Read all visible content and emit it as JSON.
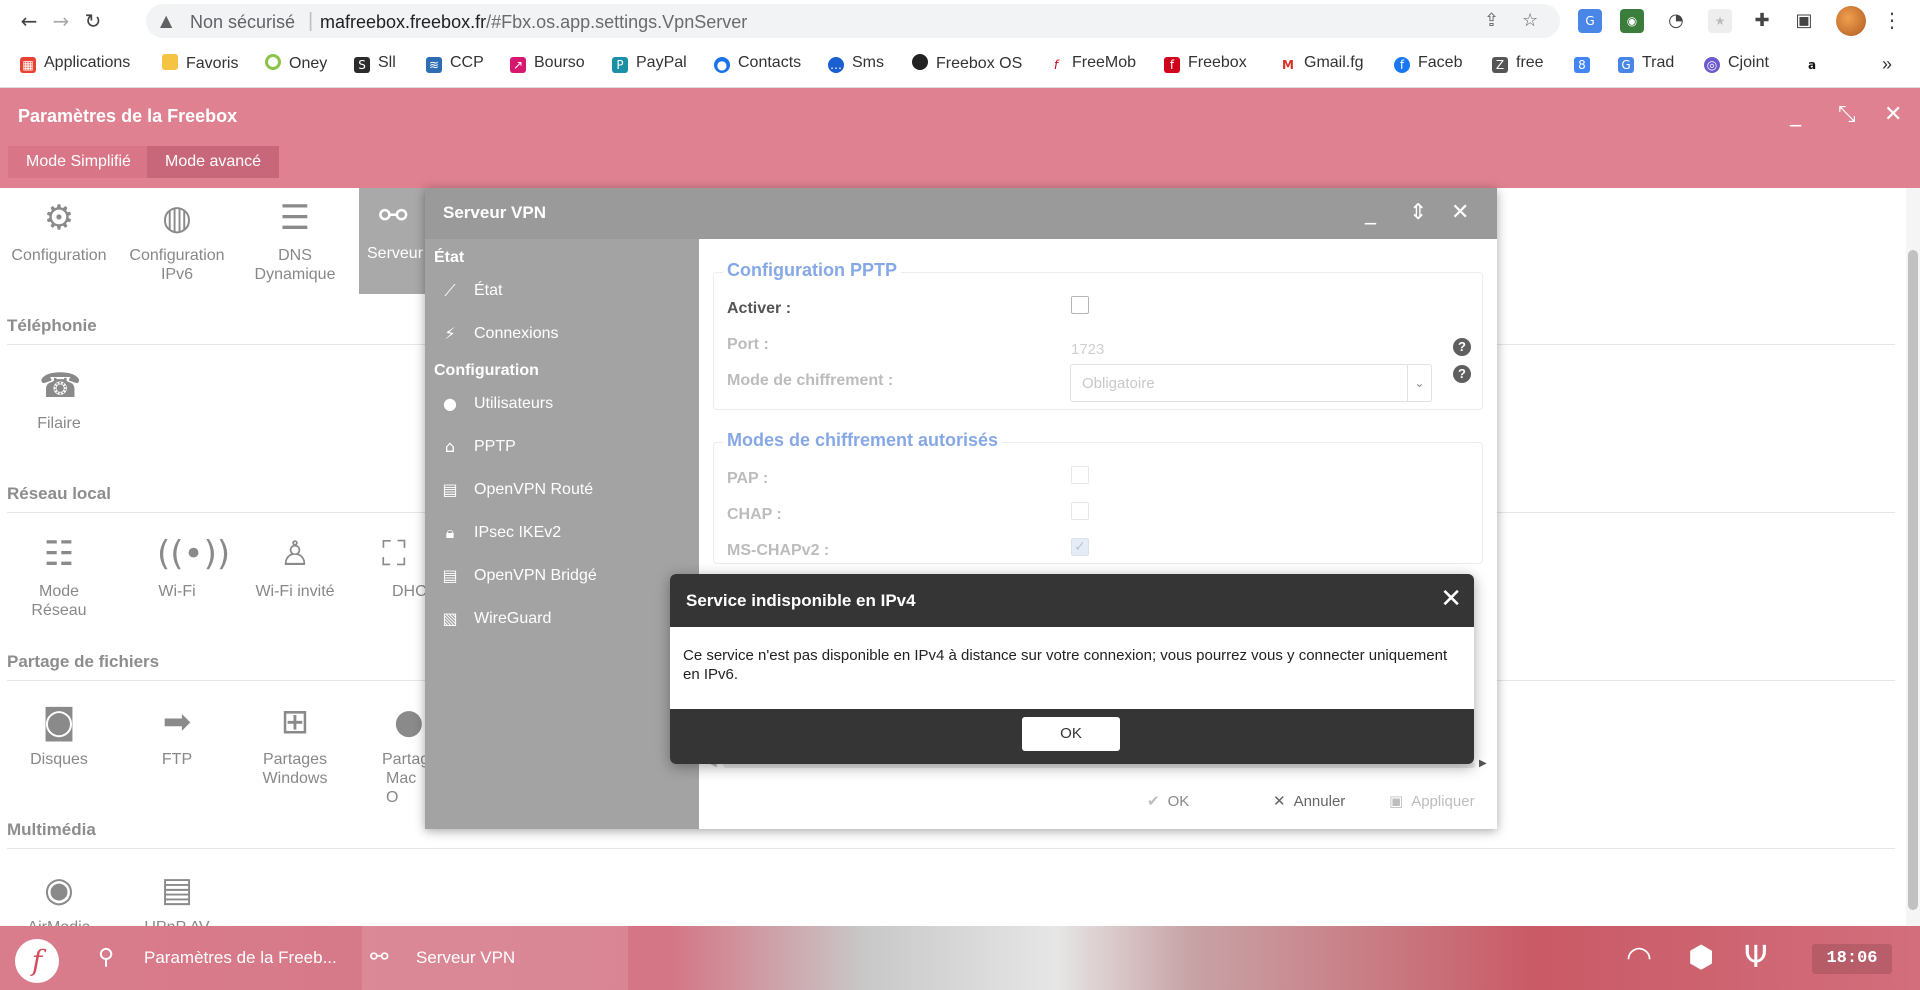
{
  "browser": {
    "security_label": "Non sécurisé",
    "url_host": "mafreebox.freebox.fr",
    "url_rest": "/#Fbx.os.app.settings.VpnServer",
    "bookmarks": [
      "Applications",
      "Favoris",
      "Oney",
      "Sll",
      "CCP",
      "Bourso",
      "PayPal",
      "Contacts",
      "Sms",
      "Freebox OS",
      "FreeMob",
      "Freebox",
      "Gmail.fg",
      "Faceb",
      "free",
      "Trad",
      "Cjoint"
    ]
  },
  "app": {
    "title": "Paramètres de la Freebox",
    "mode_simple": "Mode Simplifié",
    "mode_advanced": "Mode avancé"
  },
  "settings": {
    "sections": [
      "Téléphonie",
      "Réseau local",
      "Partage de fichiers",
      "Multimédia"
    ],
    "tiles": {
      "config": "Configuration",
      "ipv6_l1": "Configuration",
      "ipv6_l2": "IPv6",
      "dns_l1": "DNS",
      "dns_l2": "Dynamique",
      "vpn": "Serveur",
      "filaire": "Filaire",
      "mode_l1": "Mode",
      "mode_l2": "Réseau",
      "wifi": "Wi-Fi",
      "wifi_guest": "Wi-Fi invité",
      "dhcp": "DHC",
      "disks": "Disques",
      "ftp": "FTP",
      "win_l1": "Partages",
      "win_l2": "Windows",
      "mac_l1": "Partag",
      "mac_l2": "Mac O",
      "airmedia": "AirMedia",
      "upnp": "UPnP AV"
    }
  },
  "vpn": {
    "title": "Serveur VPN",
    "group_state": "État",
    "group_config": "Configuration",
    "items": [
      "État",
      "Connexions",
      "Utilisateurs",
      "PPTP",
      "OpenVPN Routé",
      "IPsec IKEv2",
      "OpenVPN Bridgé",
      "WireGuard"
    ],
    "pptp": {
      "title": "Configuration PPTP",
      "enable_label": "Activer :",
      "port_label": "Port :",
      "port_value": "1723",
      "enc_label": "Mode de chiffrement :",
      "enc_value": "Obligatoire"
    },
    "modes": {
      "title": "Modes de chiffrement autorisés",
      "pap": "PAP :",
      "chap": "CHAP :",
      "mschap": "MS-CHAPv2 :"
    },
    "footer": {
      "ok": "OK",
      "cancel": "Annuler",
      "apply": "Appliquer"
    }
  },
  "modal": {
    "title": "Service indisponible en IPv4",
    "message": "Ce service n'est pas disponible en IPv4 à distance sur votre connexion; vous pourrez vous y connecter uniquement en IPv6.",
    "ok": "OK"
  },
  "taskbar": {
    "settings": "Paramètres de la Freeb...",
    "vpn": "Serveur VPN",
    "clock": "18:06"
  },
  "colors": {
    "header": "#df8191",
    "accent_blue": "#87a8e6",
    "modal_dark": "#353535"
  }
}
